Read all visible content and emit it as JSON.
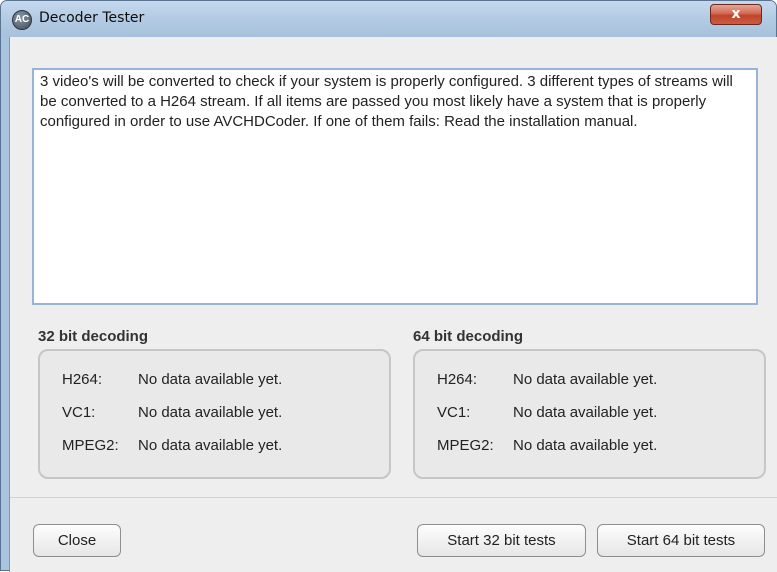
{
  "window": {
    "title": "Decoder Tester",
    "close_glyph": "x",
    "icon_text": "AC"
  },
  "description": "3 video's will be converted to check if your system is properly configured. 3 different types of streams will be converted to a H264 stream. If all items are passed you most likely have a system that is properly configured in order to use AVCHDCoder. If one of them fails: Read the installation manual.",
  "groups": [
    {
      "title": "32 bit decoding",
      "rows": [
        {
          "key": "H264:",
          "value": "No data available yet."
        },
        {
          "key": "VC1:",
          "value": "No data available yet."
        },
        {
          "key": "MPEG2:",
          "value": "No data available yet."
        }
      ]
    },
    {
      "title": "64 bit decoding",
      "rows": [
        {
          "key": "H264:",
          "value": "No data available yet."
        },
        {
          "key": "VC1:",
          "value": "No data available yet."
        },
        {
          "key": "MPEG2:",
          "value": "No data available yet."
        }
      ]
    }
  ],
  "buttons": {
    "close": "Close",
    "start32": "Start 32 bit tests",
    "start64": "Start 64 bit tests"
  },
  "colors": {
    "titlebar": "#b3cbe3",
    "close_button": "#c0432b",
    "dialog_background": "#eeeeee"
  }
}
